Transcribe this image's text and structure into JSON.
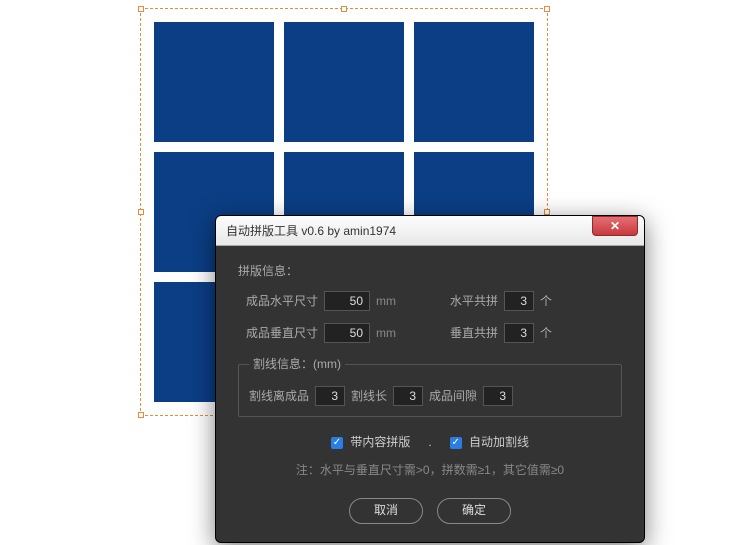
{
  "canvas": {
    "rows": 3,
    "cols": 3
  },
  "dialog": {
    "title": "自动拼版工具 v0.6   by amin1974",
    "section_layout": "拼版信息：",
    "hsize_label": "成品水平尺寸",
    "hsize_value": "50",
    "vsize_label": "成品垂直尺寸",
    "vsize_value": "50",
    "unit_mm": "mm",
    "hcount_label": "水平共拼",
    "hcount_value": "3",
    "vcount_label": "垂直共拼",
    "vcount_value": "3",
    "unit_ge": "个",
    "section_cut": "割线信息：(mm)",
    "cut_offset_label": "割线离成品",
    "cut_offset_value": "3",
    "cut_len_label": "割线长",
    "cut_len_value": "3",
    "gap_label": "成品间隙",
    "gap_value": "3",
    "check_content_label": "带内容拼版",
    "check_autoline_label": "自动加割线",
    "note": "注：水平与垂直尺寸需>0，拼数需≥1，其它值需≥0",
    "cancel": "取消",
    "ok": "确定"
  }
}
